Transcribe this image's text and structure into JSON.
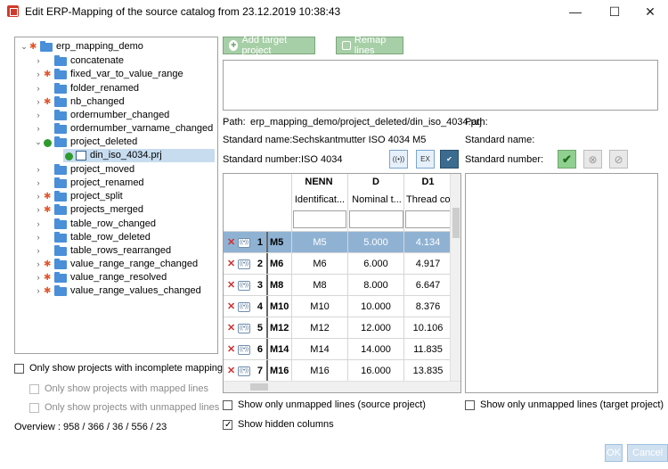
{
  "window": {
    "title": "Edit ERP-Mapping of the source catalog from 23.12.2019 10:38:43",
    "minimize_glyph": "—",
    "maximize_glyph": "☐",
    "close_glyph": "✕"
  },
  "tree": {
    "root": "erp_mapping_demo",
    "items": [
      {
        "label": "concatenate",
        "marker": "none"
      },
      {
        "label": "fixed_var_to_value_range",
        "marker": "gear"
      },
      {
        "label": "folder_renamed",
        "marker": "none"
      },
      {
        "label": "nb_changed",
        "marker": "gear"
      },
      {
        "label": "ordernumber_changed",
        "marker": "none"
      },
      {
        "label": "ordernumber_varname_changed",
        "marker": "none"
      },
      {
        "label": "project_deleted",
        "marker": "check"
      },
      {
        "label": "din_iso_4034.prj",
        "marker": "check"
      },
      {
        "label": "project_moved",
        "marker": "none"
      },
      {
        "label": "project_renamed",
        "marker": "none"
      },
      {
        "label": "project_split",
        "marker": "gear"
      },
      {
        "label": "projects_merged",
        "marker": "gear"
      },
      {
        "label": "table_row_changed",
        "marker": "none"
      },
      {
        "label": "table_row_deleted",
        "marker": "none"
      },
      {
        "label": "table_rows_rearranged",
        "marker": "none"
      },
      {
        "label": "value_range_range_changed",
        "marker": "gear"
      },
      {
        "label": "value_range_resolved",
        "marker": "gear"
      },
      {
        "label": "value_range_values_changed",
        "marker": "gear"
      }
    ]
  },
  "filters": {
    "incomplete": "Only show projects with incomplete mappings",
    "mapped": "Only show projects with mapped lines",
    "unmapped": "Only show projects with unmapped lines"
  },
  "overview": "Overview : 958 / 366 / 36 / 556 / 23",
  "toolbar": {
    "add_target": "Add target project",
    "remap": "Remap lines"
  },
  "source": {
    "path_label": "Path:",
    "path_value": "erp_mapping_demo/project_deleted/din_iso_4034.prj",
    "std_name_label": "Standard name:",
    "std_name_value": "Sechskantmutter ISO 4034 M5",
    "std_number_label": "Standard number:",
    "std_number_value": "ISO 4034"
  },
  "target": {
    "path_label": "Path:",
    "std_name_label": "Standard name:",
    "std_number_label": "Standard number:"
  },
  "table": {
    "columns": [
      {
        "code": "NENN",
        "desc": "Identificat..."
      },
      {
        "code": "D",
        "desc": "Nominal t..."
      },
      {
        "code": "D1",
        "desc": "Thread co"
      }
    ],
    "rows": [
      {
        "num": "1",
        "name": "M5",
        "nenn": "M5",
        "d": "5.000",
        "d1": "4.134"
      },
      {
        "num": "2",
        "name": "M6",
        "nenn": "M6",
        "d": "6.000",
        "d1": "4.917"
      },
      {
        "num": "3",
        "name": "M8",
        "nenn": "M8",
        "d": "8.000",
        "d1": "6.647"
      },
      {
        "num": "4",
        "name": "M10",
        "nenn": "M10",
        "d": "10.000",
        "d1": "8.376"
      },
      {
        "num": "5",
        "name": "M12",
        "nenn": "M12",
        "d": "12.000",
        "d1": "10.106"
      },
      {
        "num": "6",
        "name": "M14",
        "nenn": "M14",
        "d": "14.000",
        "d1": "11.835"
      },
      {
        "num": "7",
        "name": "M16",
        "nenn": "M16",
        "d": "16.000",
        "d1": "13.835"
      }
    ]
  },
  "options": {
    "unmapped_source": "Show only unmapped lines (source project)",
    "unmapped_target": "Show only unmapped lines (target project)",
    "hidden_columns": "Show hidden columns"
  },
  "footer": {
    "ok": "OK",
    "cancel": "Cancel"
  }
}
